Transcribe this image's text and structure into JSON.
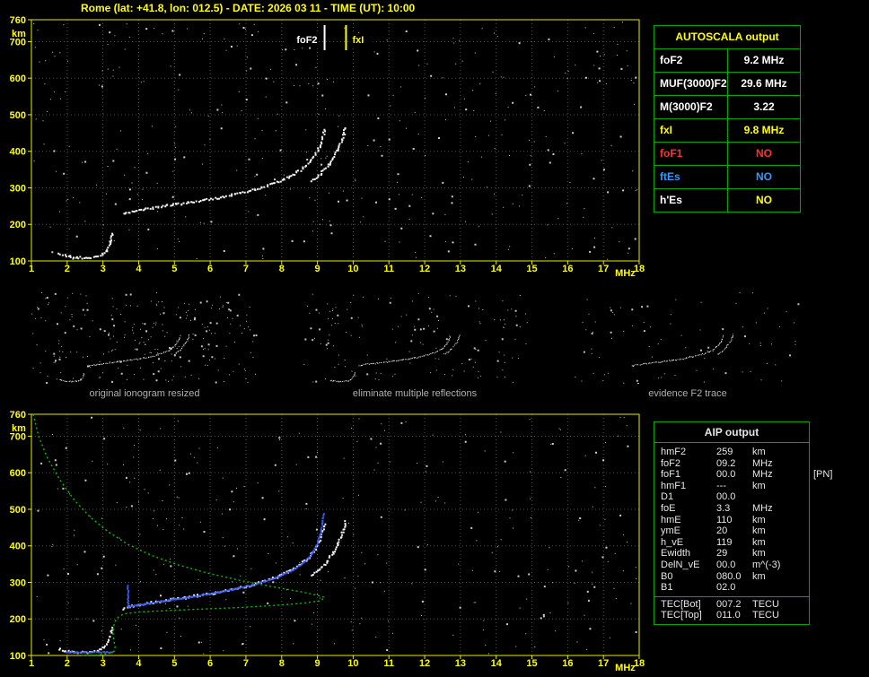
{
  "header": {
    "title": "Rome (lat: +41.8, lon: 012.5) - DATE: 2026 03 11 - TIME (UT): 10:00"
  },
  "colors": {
    "axis": "#e8e800",
    "tick_text": "#ffff00",
    "grid": "#4f4f4f",
    "table_border": "#00a800",
    "trace": "#ffffff",
    "fitted_trace": "#3a5bff",
    "profile": "#00c000",
    "caption_text": "#b0b0b0"
  },
  "autoscala": {
    "title": "AUTOSCALA output",
    "rows": [
      {
        "param": "foF2",
        "value": "9.2 MHz",
        "param_color": "#ffffff",
        "value_color": "#ffffff"
      },
      {
        "param": "MUF(3000)F2",
        "value": "29.6 MHz",
        "param_color": "#ffffff",
        "value_color": "#ffffff"
      },
      {
        "param": "M(3000)F2",
        "value": "3.22",
        "param_color": "#ffffff",
        "value_color": "#ffffff"
      },
      {
        "param": "fxI",
        "value": "9.8 MHz",
        "param_color": "#ffff00",
        "value_color": "#ffff00"
      },
      {
        "param": "foF1",
        "value": "NO",
        "param_color": "#ff3030",
        "value_color": "#ff3030"
      },
      {
        "param": "ftEs",
        "value": "NO",
        "param_color": "#3399ff",
        "value_color": "#3399ff"
      },
      {
        "param": "h'Es",
        "value": "NO",
        "param_color": "#ffffff",
        "value_color": "#ffff00"
      }
    ]
  },
  "thumbnails": {
    "captions": [
      "original ionogram resized",
      "eliminate multiple reflections",
      "evidence F2 trace"
    ]
  },
  "aip": {
    "title": "AIP output",
    "rows": [
      {
        "param": "hmF2",
        "value": "259",
        "unit": "km"
      },
      {
        "param": "foF2",
        "value": "09.2",
        "unit": "MHz"
      },
      {
        "param": "foF1",
        "value": "00.0",
        "unit": "MHz",
        "note": "[PN]"
      },
      {
        "param": "hmF1",
        "value": "---",
        "unit": "km"
      },
      {
        "param": "D1",
        "value": "00.0",
        "unit": ""
      },
      {
        "param": "foE",
        "value": "3.3",
        "unit": "MHz"
      },
      {
        "param": "hmE",
        "value": "110",
        "unit": "km"
      },
      {
        "param": "ymE",
        "value": "20",
        "unit": "km"
      },
      {
        "param": "h_vE",
        "value": "119",
        "unit": "km"
      },
      {
        "param": "Ewidth",
        "value": "29",
        "unit": "km"
      },
      {
        "param": "DelN_vE",
        "value": "00.0",
        "unit": "m^(-3)"
      },
      {
        "param": "B0",
        "value": "080.0",
        "unit": "km"
      },
      {
        "param": "B1",
        "value": "02.0",
        "unit": ""
      }
    ],
    "tec_rows": [
      {
        "param": "TEC[Bot]",
        "value": "007.2",
        "unit": "TECU"
      },
      {
        "param": "TEC[Top]",
        "value": "011.0",
        "unit": "TECU"
      }
    ]
  },
  "chart_data": [
    {
      "type": "scatter",
      "name": "ionogram",
      "xlabel": "MHz",
      "ylabel": "km",
      "xlim": [
        1,
        18
      ],
      "ylim": [
        100,
        760
      ],
      "xticks": [
        1,
        2,
        3,
        4,
        5,
        6,
        7,
        8,
        9,
        10,
        11,
        12,
        13,
        14,
        15,
        16,
        17,
        18
      ],
      "yticks": [
        100,
        200,
        300,
        400,
        500,
        600,
        700,
        760
      ],
      "grid": true,
      "markers": [
        {
          "label": "foF2",
          "x": 9.2,
          "color": "#ffffff",
          "side": "left"
        },
        {
          "label": "fxI",
          "x": 9.8,
          "color": "#ffff00",
          "side": "right"
        }
      ],
      "series": [
        {
          "name": "e-trace",
          "color": "#ffffff",
          "points": [
            [
              1.75,
              120
            ],
            [
              1.95,
              115
            ],
            [
              2.2,
              112
            ],
            [
              2.5,
              111
            ],
            [
              2.75,
              113
            ],
            [
              2.95,
              119
            ],
            [
              3.08,
              131
            ],
            [
              3.16,
              148
            ],
            [
              3.22,
              166
            ],
            [
              3.26,
              182
            ]
          ]
        },
        {
          "name": "f-trace-o",
          "color": "#ffffff",
          "points": [
            [
              3.55,
              231
            ],
            [
              3.75,
              236
            ],
            [
              4.0,
              241
            ],
            [
              4.3,
              246
            ],
            [
              4.7,
              252
            ],
            [
              5.1,
              258
            ],
            [
              5.5,
              264
            ],
            [
              5.9,
              270
            ],
            [
              6.3,
              277
            ],
            [
              6.7,
              285
            ],
            [
              7.1,
              294
            ],
            [
              7.5,
              305
            ],
            [
              7.9,
              319
            ],
            [
              8.2,
              333
            ],
            [
              8.5,
              350
            ],
            [
              8.75,
              371
            ],
            [
              8.95,
              396
            ],
            [
              9.08,
              424
            ],
            [
              9.15,
              448
            ],
            [
              9.19,
              468
            ]
          ]
        },
        {
          "name": "f-trace-x",
          "color": "#ffffff",
          "points": [
            [
              8.82,
              320
            ],
            [
              9.02,
              336
            ],
            [
              9.22,
              356
            ],
            [
              9.4,
              380
            ],
            [
              9.55,
              406
            ],
            [
              9.66,
              432
            ],
            [
              9.73,
              455
            ],
            [
              9.77,
              472
            ]
          ]
        }
      ]
    },
    {
      "type": "scatter",
      "name": "ionogram-with-profile",
      "xlabel": "MHz",
      "ylabel": "km",
      "xlim": [
        1,
        18
      ],
      "ylim": [
        100,
        760
      ],
      "xticks": [
        1,
        2,
        3,
        4,
        5,
        6,
        7,
        8,
        9,
        10,
        11,
        12,
        13,
        14,
        15,
        16,
        17,
        18
      ],
      "yticks": [
        100,
        200,
        300,
        400,
        500,
        600,
        700,
        760
      ],
      "grid": true,
      "series": [
        {
          "name": "e-trace",
          "color": "#ffffff",
          "points": [
            [
              1.75,
              120
            ],
            [
              1.95,
              115
            ],
            [
              2.2,
              112
            ],
            [
              2.5,
              111
            ],
            [
              2.75,
              113
            ],
            [
              2.95,
              119
            ],
            [
              3.08,
              131
            ],
            [
              3.16,
              148
            ],
            [
              3.22,
              166
            ],
            [
              3.26,
              182
            ]
          ]
        },
        {
          "name": "f-trace-o",
          "color": "#ffffff",
          "points": [
            [
              3.55,
              231
            ],
            [
              3.75,
              236
            ],
            [
              4.0,
              241
            ],
            [
              4.3,
              246
            ],
            [
              4.7,
              252
            ],
            [
              5.1,
              258
            ],
            [
              5.5,
              264
            ],
            [
              5.9,
              270
            ],
            [
              6.3,
              277
            ],
            [
              6.7,
              285
            ],
            [
              7.1,
              294
            ],
            [
              7.5,
              305
            ],
            [
              7.9,
              319
            ],
            [
              8.2,
              333
            ],
            [
              8.5,
              350
            ],
            [
              8.75,
              371
            ],
            [
              8.95,
              396
            ],
            [
              9.08,
              424
            ],
            [
              9.15,
              448
            ],
            [
              9.19,
              468
            ]
          ]
        },
        {
          "name": "f-trace-x",
          "color": "#ffffff",
          "points": [
            [
              8.82,
              320
            ],
            [
              9.02,
              336
            ],
            [
              9.22,
              356
            ],
            [
              9.4,
              380
            ],
            [
              9.55,
              406
            ],
            [
              9.66,
              432
            ],
            [
              9.73,
              455
            ],
            [
              9.77,
              472
            ]
          ]
        },
        {
          "name": "autoscala-fitted-trace",
          "color": "#3a5bff",
          "points": [
            [
              3.68,
              293
            ],
            [
              3.68,
              270
            ],
            [
              3.68,
              248
            ],
            [
              3.7,
              235
            ],
            [
              3.85,
              238
            ],
            [
              4.1,
              242
            ],
            [
              4.4,
              247
            ],
            [
              4.8,
              253
            ],
            [
              5.2,
              259
            ],
            [
              5.6,
              265
            ],
            [
              6.0,
              272
            ],
            [
              6.4,
              279
            ],
            [
              6.8,
              287
            ],
            [
              7.2,
              296
            ],
            [
              7.6,
              308
            ],
            [
              8.0,
              322
            ],
            [
              8.3,
              337
            ],
            [
              8.6,
              356
            ],
            [
              8.8,
              378
            ],
            [
              8.95,
              402
            ],
            [
              9.05,
              430
            ],
            [
              9.12,
              462
            ],
            [
              9.15,
              495
            ]
          ]
        },
        {
          "name": "fitted-e-trace",
          "color": "#3a5bff",
          "points": [
            [
              1.95,
              111
            ],
            [
              2.4,
              111
            ],
            [
              2.9,
              111
            ],
            [
              3.3,
              111
            ]
          ]
        },
        {
          "name": "electron-density-profile",
          "color": "#00c000",
          "style": "dotted-line",
          "points": [
            [
              1.05,
              760
            ],
            [
              1.2,
              700
            ],
            [
              1.45,
              640
            ],
            [
              1.8,
              580
            ],
            [
              2.2,
              525
            ],
            [
              2.65,
              478
            ],
            [
              3.15,
              438
            ],
            [
              3.7,
              404
            ],
            [
              4.35,
              374
            ],
            [
              5.1,
              348
            ],
            [
              5.9,
              326
            ],
            [
              6.8,
              306
            ],
            [
              7.7,
              289
            ],
            [
              8.5,
              275
            ],
            [
              9.0,
              265
            ],
            [
              9.2,
              259
            ],
            [
              9.1,
              250
            ],
            [
              8.6,
              243
            ],
            [
              7.8,
              237
            ],
            [
              6.8,
              231
            ],
            [
              5.8,
              227
            ],
            [
              4.8,
              223
            ],
            [
              4.0,
              219
            ],
            [
              3.6,
              214
            ],
            [
              3.45,
              207
            ],
            [
              3.35,
              196
            ],
            [
              3.3,
              180
            ],
            [
              3.28,
              162
            ],
            [
              3.3,
              143
            ],
            [
              3.34,
              124
            ],
            [
              3.32,
              112
            ],
            [
              3.15,
              105
            ],
            [
              2.8,
              101
            ],
            [
              2.35,
              100
            ]
          ]
        }
      ]
    }
  ]
}
